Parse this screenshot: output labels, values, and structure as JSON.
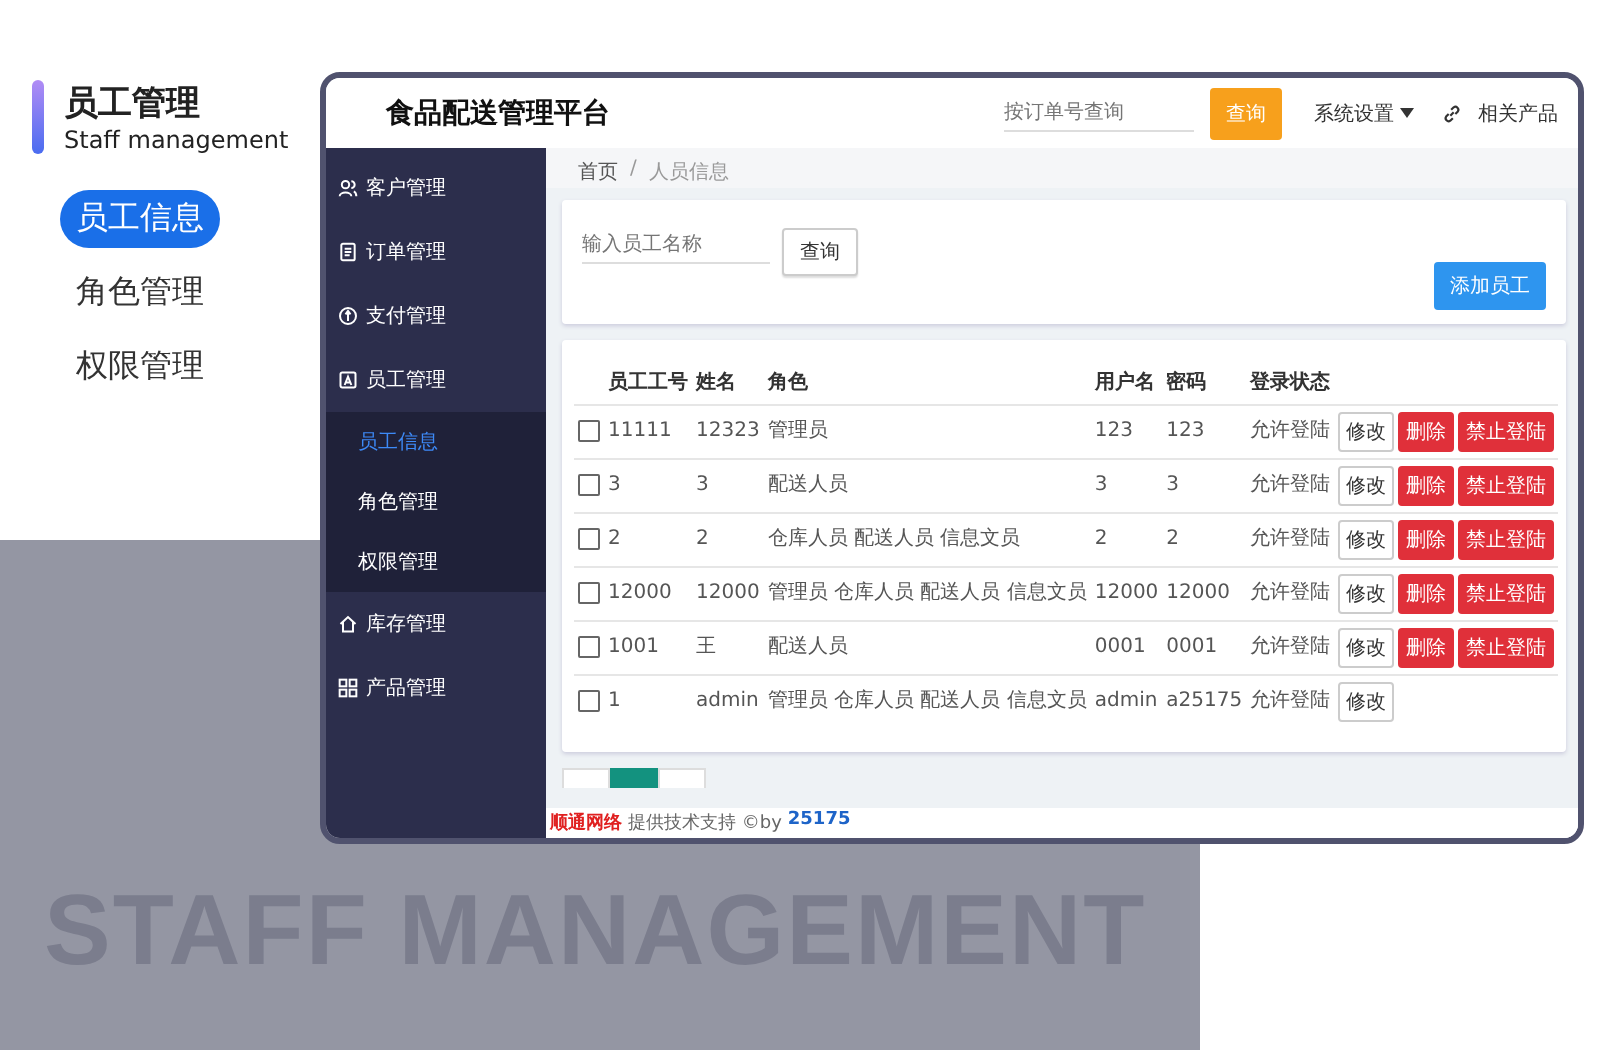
{
  "promo": {
    "title": "员工管理",
    "subtitle": "Staff management",
    "menu": [
      {
        "label": "员工信息",
        "selected": true
      },
      {
        "label": "角色管理",
        "selected": false
      },
      {
        "label": "权限管理",
        "selected": false
      }
    ],
    "banner": "STAFF MANAGEMENT"
  },
  "app": {
    "title": "食品配送管理平台",
    "order_search": {
      "placeholder": "按订单号查询",
      "button": "查询"
    },
    "settings_menu": "系统设置",
    "related_link": "相关产品",
    "sidebar": [
      {
        "label": "客户管理"
      },
      {
        "label": "订单管理"
      },
      {
        "label": "支付管理"
      },
      {
        "label": "员工管理",
        "children": [
          {
            "label": "员工信息",
            "selected": true
          },
          {
            "label": "角色管理",
            "selected": false
          },
          {
            "label": "权限管理",
            "selected": false
          }
        ]
      },
      {
        "label": "库存管理"
      },
      {
        "label": "产品管理"
      }
    ],
    "breadcrumb": {
      "items": [
        "首页",
        "人员信息"
      ],
      "separator": "/"
    },
    "staff_search": {
      "placeholder": "输入员工名称",
      "button": "查询"
    },
    "add_button": "添加员工",
    "table": {
      "columns": [
        "员工工号",
        "姓名",
        "角色",
        "用户名",
        "密码",
        "登录状态"
      ],
      "rows": [
        {
          "checked": false,
          "cells": [
            "11111",
            "12323",
            "管理员",
            "123",
            "123",
            "允许登陆"
          ],
          "actions": [
            {
              "label": "修改",
              "kind": "edit"
            },
            {
              "label": "删除",
              "kind": "danger"
            },
            {
              "label": "禁止登陆",
              "kind": "danger"
            }
          ]
        },
        {
          "checked": false,
          "cells": [
            "3",
            "3",
            "配送人员",
            "3",
            "3",
            "允许登陆"
          ],
          "actions": [
            {
              "label": "修改",
              "kind": "edit"
            },
            {
              "label": "删除",
              "kind": "danger"
            },
            {
              "label": "禁止登陆",
              "kind": "danger"
            }
          ]
        },
        {
          "checked": false,
          "cells": [
            "2",
            "2",
            "仓库人员 配送人员 信息文员",
            "2",
            "2",
            "允许登陆"
          ],
          "actions": [
            {
              "label": "修改",
              "kind": "edit"
            },
            {
              "label": "删除",
              "kind": "danger"
            },
            {
              "label": "禁止登陆",
              "kind": "danger"
            }
          ]
        },
        {
          "checked": false,
          "cells": [
            "12000",
            "12000",
            "管理员 仓库人员 配送人员 信息文员",
            "12000",
            "12000",
            "允许登陆"
          ],
          "actions": [
            {
              "label": "修改",
              "kind": "edit"
            },
            {
              "label": "删除",
              "kind": "danger"
            },
            {
              "label": "禁止登陆",
              "kind": "danger"
            }
          ]
        },
        {
          "checked": false,
          "cells": [
            "1001",
            "王",
            "配送人员",
            "0001",
            "0001",
            "允许登陆"
          ],
          "actions": [
            {
              "label": "修改",
              "kind": "edit"
            },
            {
              "label": "删除",
              "kind": "danger"
            },
            {
              "label": "禁止登陆",
              "kind": "danger"
            }
          ]
        },
        {
          "checked": false,
          "cells": [
            "1",
            "admin",
            "管理员 仓库人员 配送人员 信息文员",
            "admin",
            "a25175",
            "允许登陆"
          ],
          "actions": [
            {
              "label": "修改",
              "kind": "edit"
            }
          ]
        }
      ]
    },
    "pagination": {
      "pages": [
        {
          "selected": true
        }
      ]
    },
    "footer": {
      "company": "顺通网络",
      "text": "提供技术支持 ©by",
      "author": "25175"
    }
  }
}
